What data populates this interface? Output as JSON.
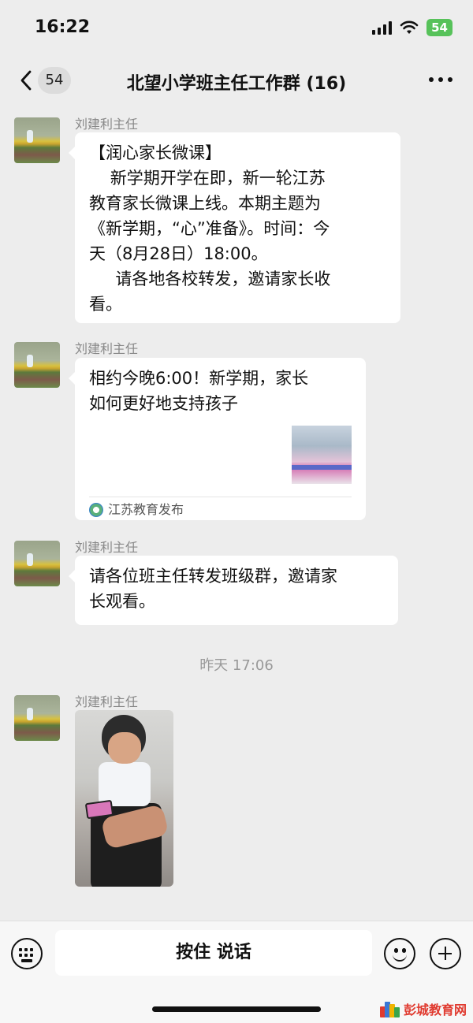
{
  "status_bar": {
    "time": "16:22",
    "battery": "54"
  },
  "nav": {
    "unread_count": "54",
    "title": "北望小学班主任工作群 (16)"
  },
  "messages": [
    {
      "sender": "刘建利主任",
      "lines": [
        "【润心家长微课】",
        "    新学期开学在即，新一轮江苏",
        "教育家长微课上线。本期主题为",
        "《新学期，“心”准备》。时间：今",
        "天（8月28日）18:00。",
        "     请各地各校转发，邀请家长收",
        "看。"
      ]
    },
    {
      "sender": "刘建利主任",
      "card_title_lines": [
        "相约今晚6:00！新学期，家长",
        "如何更好地支持孩子"
      ],
      "card_source": "江苏教育发布"
    },
    {
      "sender": "刘建利主任",
      "lines": [
        "请各位班主任转发班级群，邀请家",
        "长观看。"
      ]
    },
    {
      "sender": "刘建利主任"
    }
  ],
  "timestamp": "昨天 17:06",
  "input_bar": {
    "hold_to_talk": "按住 说话"
  },
  "watermark": "彭城教育网"
}
